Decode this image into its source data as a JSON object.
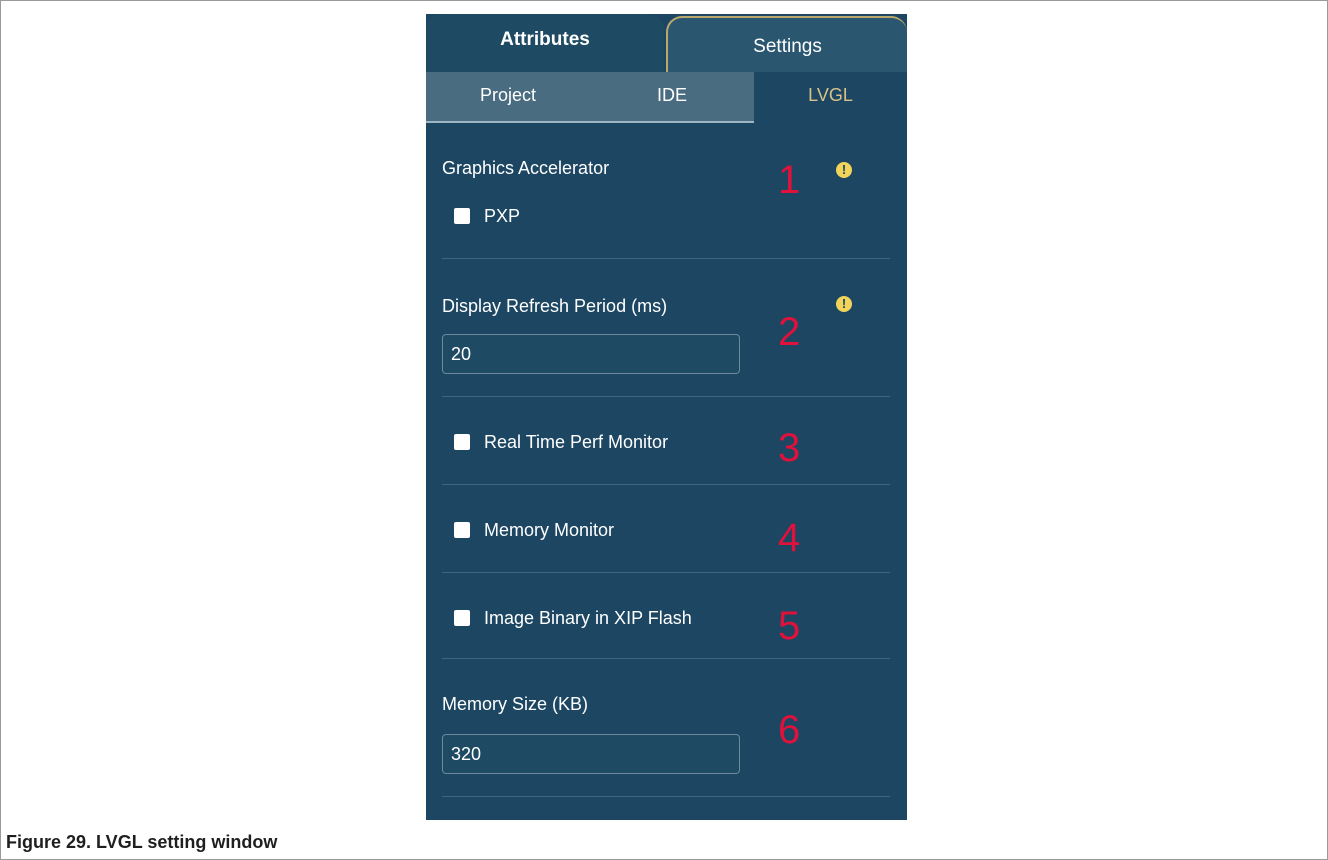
{
  "tabs": {
    "attributes": "Attributes",
    "settings": "Settings"
  },
  "subtabs": {
    "project": "Project",
    "ide": "IDE",
    "lvgl": "LVGL"
  },
  "graphics": {
    "label": "Graphics Accelerator",
    "pxp": "PXP",
    "pxp_checked": false,
    "marker": "1"
  },
  "refresh": {
    "label": "Display Refresh Period  (ms)",
    "value": "20",
    "marker": "2"
  },
  "perf": {
    "label": "Real Time Perf Monitor",
    "checked": false,
    "marker": "3"
  },
  "memmon": {
    "label": "Memory Monitor",
    "checked": false,
    "marker": "4"
  },
  "xip": {
    "label": "Image Binary in XIP Flash",
    "checked": false,
    "marker": "5"
  },
  "memsize": {
    "label": "Memory Size (KB)",
    "value": "320",
    "marker": "6"
  },
  "warning_glyph": "!",
  "caption": "Figure 29.  LVGL setting window",
  "colors": {
    "panel": "#1c4662",
    "marker": "#e0113b",
    "active_tab": "#d6c28a",
    "warning": "#f2d45a"
  }
}
